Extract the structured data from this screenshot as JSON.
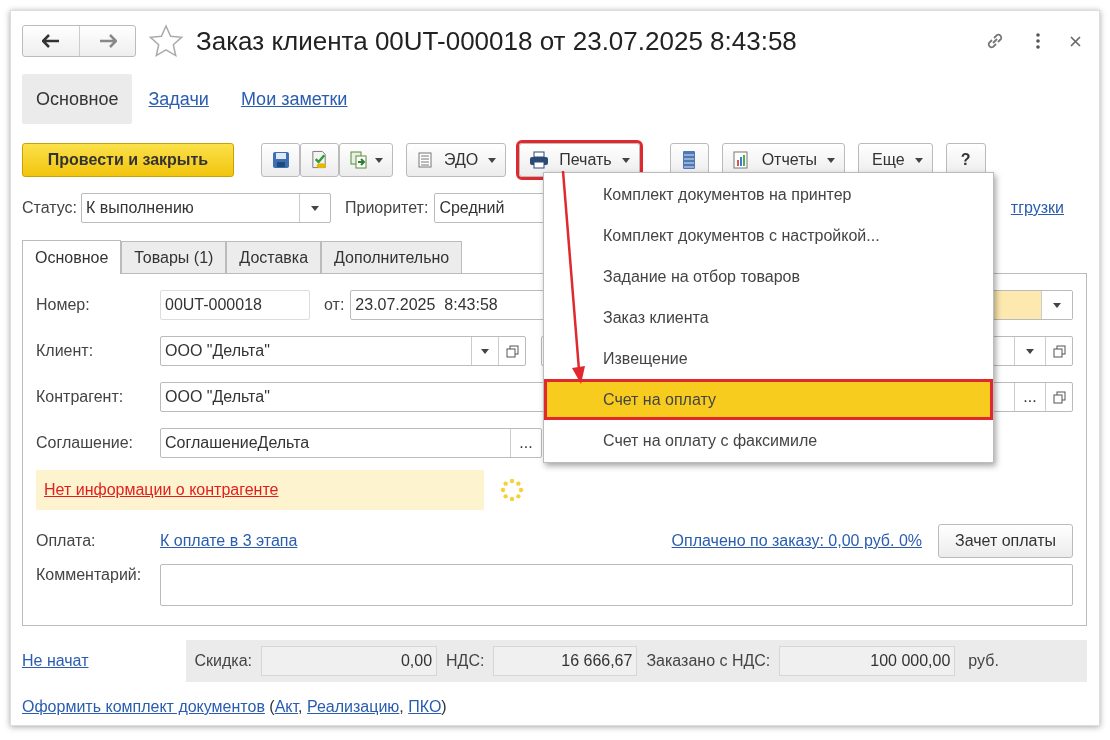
{
  "window": {
    "title": "Заказ клиента 00UT-000018 от 23.07.2025 8:43:58"
  },
  "section_tabs": [
    {
      "label": "Основное",
      "selected": true
    },
    {
      "label": "Задачи",
      "selected": false
    },
    {
      "label": "Мои заметки",
      "selected": false
    }
  ],
  "toolbar": [
    {
      "kind": "primary",
      "label": "Провести и закрыть"
    },
    {
      "kind": "icon"
    },
    {
      "kind": "icon"
    },
    {
      "kind": "icon_menu"
    },
    {
      "kind": "menu",
      "label": "ЭДО",
      "annotated": false
    },
    {
      "kind": "menu",
      "label": "Печать",
      "annotated": true
    },
    {
      "kind": "icon"
    },
    {
      "kind": "menu",
      "label": "Отчеты",
      "annotated": false
    },
    {
      "kind": "menu",
      "label": "Еще",
      "annotated": false
    },
    {
      "kind": "text",
      "label": "?"
    }
  ],
  "status": {
    "label": "Статус:",
    "value": "К выполнению"
  },
  "priority": {
    "label": "Приоритет:",
    "value": "Средний"
  },
  "shipment_link": "тгрузки",
  "form_tabs": [
    {
      "label": "Основное",
      "selected": true
    },
    {
      "label": "Товары (1)",
      "selected": false
    },
    {
      "label": "Доставка",
      "selected": false
    },
    {
      "label": "Дополнительно",
      "selected": false
    }
  ],
  "number": {
    "label": "Номер:",
    "value": "00UT-000018",
    "date_label": "от:",
    "date": "23.07.2025  8:43:58"
  },
  "client": {
    "label": "Клиент:",
    "value": "ООО \"Дельта\""
  },
  "counterparty": {
    "label": "Контрагент:",
    "value": "ООО \"Дельта\""
  },
  "agreement": {
    "label": "Соглашение:",
    "value": "СоглашениеДельта",
    "button": "..."
  },
  "right_buttons": [
    "..."
  ],
  "warning": "Нет информации о контрагенте",
  "payment": {
    "label": "Оплата:",
    "link": "К оплате в 3 этапа",
    "paid_link": "Оплачено по заказу: 0,00 руб. 0%",
    "button": "Зачет оплаты"
  },
  "comment": {
    "label": "Комментарий:"
  },
  "state_link": "Не начат",
  "totals": [
    {
      "label": "Скидка:",
      "value": "0,00"
    },
    {
      "label": "НДС:",
      "value": "16 666,67"
    },
    {
      "label": "Заказано с НДС:",
      "value": "100 000,00"
    }
  ],
  "currency": "руб.",
  "footer": {
    "link": "Оформить комплект документов",
    "open": " (",
    "links": [
      "Акт",
      "Реализацию",
      "ПКО"
    ],
    "sep": ", ",
    "close": ")"
  },
  "print_menu": [
    {
      "label": "Комплект документов на принтер",
      "selected": false,
      "annotated": false
    },
    {
      "label": "Комплект документов с настройкой...",
      "selected": false,
      "annotated": false
    },
    {
      "label": "Задание на отбор товаров",
      "selected": false,
      "annotated": false
    },
    {
      "label": "Заказ клиента",
      "selected": false,
      "annotated": false
    },
    {
      "label": "Извещение",
      "selected": false,
      "annotated": false
    },
    {
      "label": "Счет на оплату",
      "selected": true,
      "annotated": true
    },
    {
      "label": "Счет на оплату с факсимиле",
      "selected": false,
      "annotated": false
    }
  ]
}
